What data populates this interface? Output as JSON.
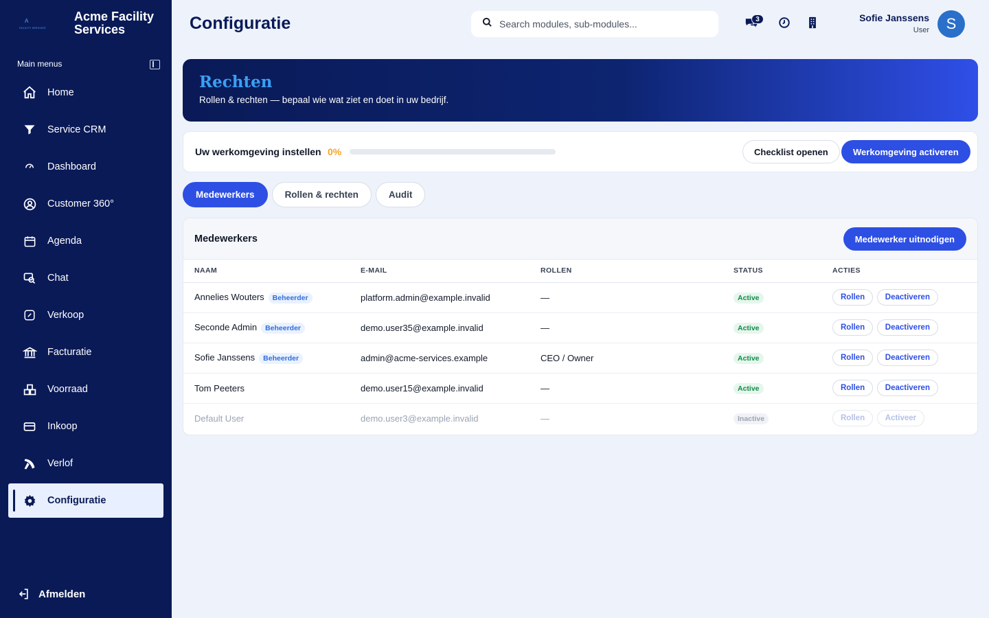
{
  "brand": {
    "logo_letter": "A",
    "logo_sub": "FACILITY SERVICES",
    "name": "Acme Facility Services"
  },
  "sidebar": {
    "heading": "Main menus",
    "items": [
      {
        "label": "Home",
        "icon": "home-icon"
      },
      {
        "label": "Service CRM",
        "icon": "funnel-icon"
      },
      {
        "label": "Dashboard",
        "icon": "gauge-icon"
      },
      {
        "label": "Customer 360°",
        "icon": "user-circle-icon"
      },
      {
        "label": "Agenda",
        "icon": "calendar-icon"
      },
      {
        "label": "Chat",
        "icon": "chat-icon"
      },
      {
        "label": "Verkoop",
        "icon": "percent-icon"
      },
      {
        "label": "Facturatie",
        "icon": "bank-icon"
      },
      {
        "label": "Voorraad",
        "icon": "warehouse-icon"
      },
      {
        "label": "Inkoop",
        "icon": "card-icon"
      },
      {
        "label": "Verlof",
        "icon": "plane-icon"
      },
      {
        "label": "Configuratie",
        "icon": "gear-icon",
        "active": true
      }
    ],
    "logout": "Afmelden"
  },
  "header": {
    "title": "Configuratie",
    "search_placeholder": "Search modules, sub-modules...",
    "chat_badge": "3",
    "user_name": "Sofie Janssens",
    "user_role": "User",
    "avatar_letter": "S"
  },
  "hero": {
    "title": "Rechten",
    "subtitle": "Rollen & rechten — bepaal wie wat ziet en doet in uw bedrijf."
  },
  "setup": {
    "title": "Uw werkomgeving instellen",
    "progress_label": "0%",
    "progress": 0,
    "checklist_button": "Checklist openen",
    "activate_button": "Werkomgeving activeren"
  },
  "tabs": [
    "Medewerkers",
    "Rollen & rechten",
    "Audit"
  ],
  "table": {
    "title": "Medewerkers",
    "invite_button": "Medewerker uitnodigen",
    "columns": [
      "NAAM",
      "E-MAIL",
      "ROLLEN",
      "STATUS",
      "ACTIES"
    ],
    "rows": [
      {
        "name": "Annelies Wouters",
        "pill": "Beheerder",
        "email": "platform.admin@example.invalid",
        "roles": "—",
        "status": "Active",
        "action1": "Rollen",
        "action2": "Deactiveren"
      },
      {
        "name": "Seconde Admin",
        "pill": "Beheerder",
        "email": "demo.user35@example.invalid",
        "roles": "—",
        "status": "Active",
        "action1": "Rollen",
        "action2": "Deactiveren"
      },
      {
        "name": "Sofie Janssens",
        "pill": "Beheerder",
        "email": "admin@acme-services.example",
        "roles": "CEO / Owner",
        "status": "Active",
        "action1": "Rollen",
        "action2": "Deactiveren"
      },
      {
        "name": "Tom Peeters",
        "pill": "",
        "email": "demo.user15@example.invalid",
        "roles": "—",
        "status": "Active",
        "action1": "Rollen",
        "action2": "Deactiveren"
      },
      {
        "name": "Default User",
        "pill": "",
        "email": "demo.user3@example.invalid",
        "roles": "—",
        "status": "Inactive",
        "action1": "Rollen",
        "action2": "Activeer"
      }
    ]
  },
  "colors": {
    "sidebar": "#0a1a57",
    "accent": "#2e4fe3",
    "warning": "#f5a524",
    "success": "#128a4a"
  }
}
